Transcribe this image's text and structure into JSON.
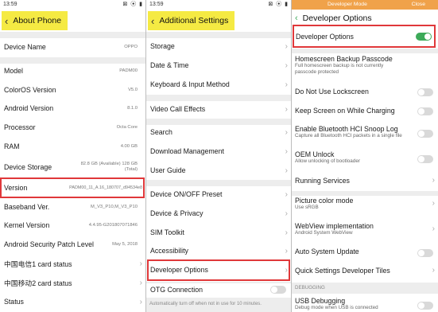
{
  "colors": {
    "highlight": "#f5ea43",
    "red_box": "#e0383a",
    "toggle_on": "#3daa59",
    "dev_banner": "#f0a24a"
  },
  "panel1": {
    "status_time": "13:59",
    "status_icons": "⊠ ⦿ ▮",
    "title": "About Phone",
    "rows": [
      {
        "label": "Device Name",
        "value": "OPPO"
      },
      {
        "label": "Model",
        "value": "PADM00"
      },
      {
        "label": "ColorOS Version",
        "value": "V5.0"
      },
      {
        "label": "Android Version",
        "value": "8.1.0"
      },
      {
        "label": "Processor",
        "value": "Octa Core"
      },
      {
        "label": "RAM",
        "value": "4.00 GB"
      },
      {
        "label": "Device Storage",
        "value": "82.8 GB (Available)  128 GB (Total)"
      },
      {
        "label": "Version",
        "value": "PADM00_11_A.16_180707_d94534e8"
      },
      {
        "label": "Baseband Ver.",
        "value": "M_V3_P10,M_V3_P10"
      },
      {
        "label": "Kernel Version",
        "value": "4.4.95-G201807071846"
      },
      {
        "label": "Android Security Patch Level",
        "value": "May 5, 2018"
      },
      {
        "label": "中国电信1 card status",
        "value": ""
      },
      {
        "label": "中国移动2 card status",
        "value": ""
      },
      {
        "label": "Status",
        "value": ""
      }
    ]
  },
  "panel2": {
    "status_time": "13:59",
    "status_icons": "⊠ ⦿ ▮",
    "title": "Additional Settings",
    "rows": [
      {
        "label": "Storage"
      },
      {
        "label": "Date & Time"
      },
      {
        "label": "Keyboard & Input Method"
      },
      {
        "label": "Video Call Effects"
      },
      {
        "label": "Search"
      },
      {
        "label": "Download Management"
      },
      {
        "label": "User Guide"
      },
      {
        "label": "Device ON/OFF Preset"
      },
      {
        "label": "Device & Privacy"
      },
      {
        "label": "SIM Toolkit"
      },
      {
        "label": "Accessibility"
      },
      {
        "label": "Developer Options"
      },
      {
        "label": "OTG Connection"
      }
    ],
    "footer_note": "Automatically turn off when not in use for 10 minutes."
  },
  "panel3": {
    "banner_left": "Developer Mode",
    "banner_right": "Close",
    "title": "Developer Options",
    "master_toggle_label": "Developer Options",
    "master_toggle_on": true,
    "items": [
      {
        "title": "Homescreen Backup Passcode",
        "sub": "Full homescreen backup is not currently passcode protected"
      },
      {
        "title": "Do Not Use Lockscreen",
        "sub": ""
      },
      {
        "title": "Keep Screen on While Charging",
        "sub": ""
      },
      {
        "title": "Enable Bluetooth HCI Snoop Log",
        "sub": "Capture all Bluetooth HCI packets in a single file"
      },
      {
        "title": "OEM Unlock",
        "sub": "Allow unlocking of bootloader"
      },
      {
        "title": "Running Services",
        "sub": ""
      },
      {
        "title": "Picture color mode",
        "sub": "Use sRGB"
      },
      {
        "title": "WebView implementation",
        "sub": "Android System WebView"
      },
      {
        "title": "Auto System Update",
        "sub": ""
      },
      {
        "title": "Quick Settings Developer Tiles",
        "sub": ""
      }
    ],
    "section_debugging": "DEBUGGING",
    "usb_debugging": "USB Debugging",
    "usb_debugging_sub": "Debug mode when USB is connected"
  }
}
